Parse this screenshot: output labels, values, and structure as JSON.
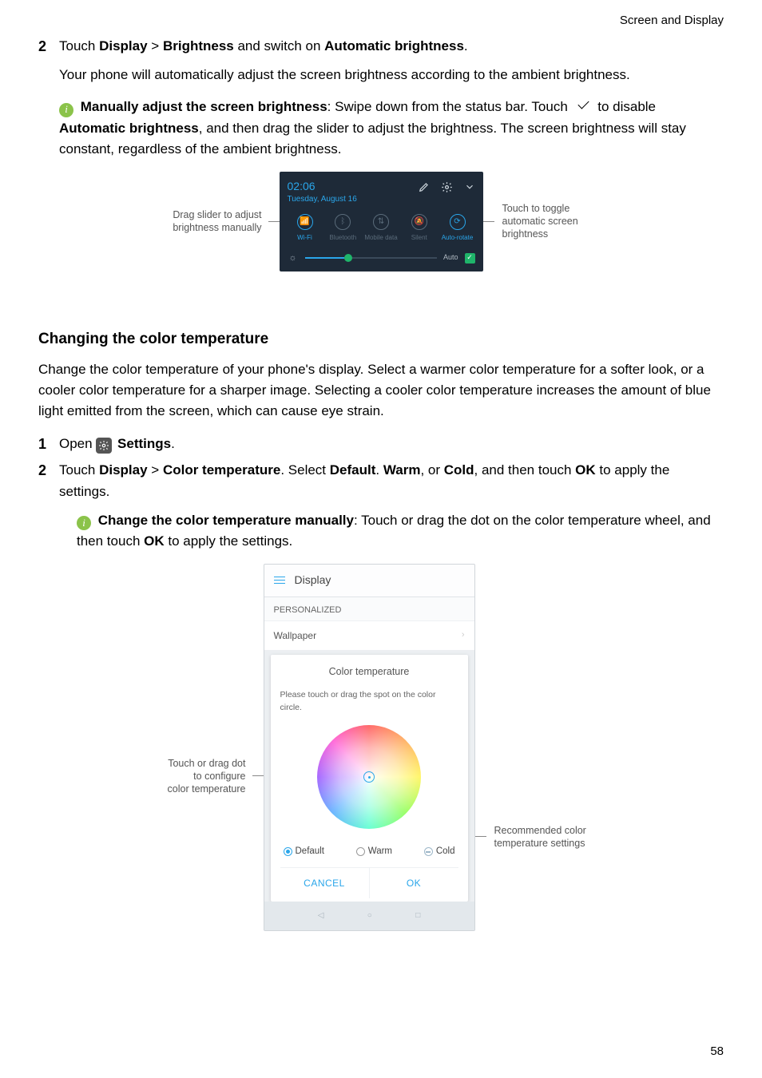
{
  "header": {
    "section_title": "Screen and Display"
  },
  "step_brightness": {
    "num": "2",
    "prefix": "Touch ",
    "d1": "Display",
    "gt1": " > ",
    "d2": "Brightness",
    "mid": " and switch on ",
    "d3": "Automatic brightness",
    "suffix": ".",
    "sub": "Your phone will automatically adjust the screen brightness according to the ambient brightness."
  },
  "info_brightness": {
    "p1_bold": "Manually adjust the screen brightness",
    "p1_a": ": Swipe down from the status bar. Touch ",
    "p1_b": " to disable ",
    "p1_bold2": "Automatic brightness",
    "p1_c": ", and then drag the slider to adjust the brightness. The screen brightness will stay constant, regardless of the ambient brightness."
  },
  "fig1": {
    "left_callout_l1": "Drag slider to adjust",
    "left_callout_l2": "brightness manually",
    "right_callout_l1": "Touch to toggle",
    "right_callout_l2": "automatic screen",
    "right_callout_l3": "brightness",
    "time": "02:06",
    "date": "Tuesday, August 16",
    "tiles": {
      "wifi": "Wi-Fi",
      "bt": "Bluetooth",
      "data": "Mobile data",
      "silent": "Silent",
      "rotate": "Auto-rotate"
    },
    "auto_label": "Auto"
  },
  "section_ct": {
    "heading": "Changing the color temperature",
    "intro": "Change the color temperature of your phone's display. Select a warmer color temperature for a softer look, or a cooler color temperature for a sharper image. Selecting a cooler color temperature increases the amount of blue light emitted from the screen, which can cause eye strain."
  },
  "step_open": {
    "num": "1",
    "prefix": "Open ",
    "label": "Settings",
    "suffix": "."
  },
  "step_ct": {
    "num": "2",
    "prefix": "Touch ",
    "d1": "Display",
    "gt1": " > ",
    "d2": "Color temperature",
    "mid1": ". Select ",
    "d3": "Default",
    "mid2": ". ",
    "d4": "Warm",
    "mid3": ", or ",
    "d5": "Cold",
    "mid4": ", and then touch ",
    "d6": "OK",
    "suffix": " to apply the settings."
  },
  "info_ct": {
    "bold": "Change the color temperature manually",
    "a": ": Touch or drag the dot on the color temperature wheel, and then touch ",
    "ok": "OK",
    "b": " to apply the settings."
  },
  "fig2": {
    "left_l1": "Touch or drag dot",
    "left_l2": "to configure",
    "left_l3": "color temperature",
    "right_l1": "Recommended color",
    "right_l2": "temperature settings",
    "header": "Display",
    "subheader": "PERSONALIZED",
    "row_wallpaper": "Wallpaper",
    "dialog_title": "Color temperature",
    "dialog_hint": "Please touch or drag the spot on the color circle.",
    "opt_default": "Default",
    "opt_warm": "Warm",
    "opt_cold": "Cold",
    "btn_cancel": "CANCEL",
    "btn_ok": "OK"
  },
  "page_number": "58"
}
